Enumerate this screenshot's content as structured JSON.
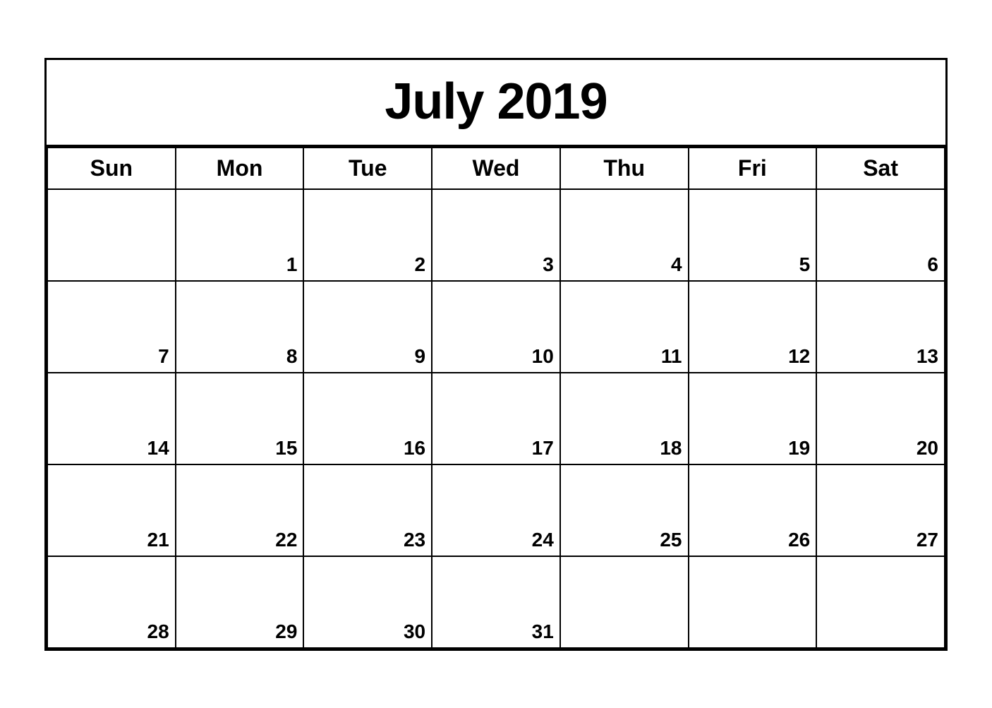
{
  "calendar": {
    "title": "July 2019",
    "days_of_week": [
      "Sun",
      "Mon",
      "Tue",
      "Wed",
      "Thu",
      "Fri",
      "Sat"
    ],
    "weeks": [
      [
        {
          "day": "",
          "empty": true
        },
        {
          "day": "1",
          "empty": false
        },
        {
          "day": "2",
          "empty": false
        },
        {
          "day": "3",
          "empty": false
        },
        {
          "day": "4",
          "empty": false
        },
        {
          "day": "5",
          "empty": false
        },
        {
          "day": "6",
          "empty": false
        }
      ],
      [
        {
          "day": "7",
          "empty": false
        },
        {
          "day": "8",
          "empty": false
        },
        {
          "day": "9",
          "empty": false
        },
        {
          "day": "10",
          "empty": false
        },
        {
          "day": "11",
          "empty": false
        },
        {
          "day": "12",
          "empty": false
        },
        {
          "day": "13",
          "empty": false
        }
      ],
      [
        {
          "day": "14",
          "empty": false
        },
        {
          "day": "15",
          "empty": false
        },
        {
          "day": "16",
          "empty": false
        },
        {
          "day": "17",
          "empty": false
        },
        {
          "day": "18",
          "empty": false
        },
        {
          "day": "19",
          "empty": false
        },
        {
          "day": "20",
          "empty": false
        }
      ],
      [
        {
          "day": "21",
          "empty": false
        },
        {
          "day": "22",
          "empty": false
        },
        {
          "day": "23",
          "empty": false
        },
        {
          "day": "24",
          "empty": false
        },
        {
          "day": "25",
          "empty": false
        },
        {
          "day": "26",
          "empty": false
        },
        {
          "day": "27",
          "empty": false
        }
      ],
      [
        {
          "day": "28",
          "empty": false
        },
        {
          "day": "29",
          "empty": false
        },
        {
          "day": "30",
          "empty": false
        },
        {
          "day": "31",
          "empty": false
        },
        {
          "day": "",
          "empty": true
        },
        {
          "day": "",
          "empty": true
        },
        {
          "day": "",
          "empty": true
        }
      ]
    ]
  }
}
